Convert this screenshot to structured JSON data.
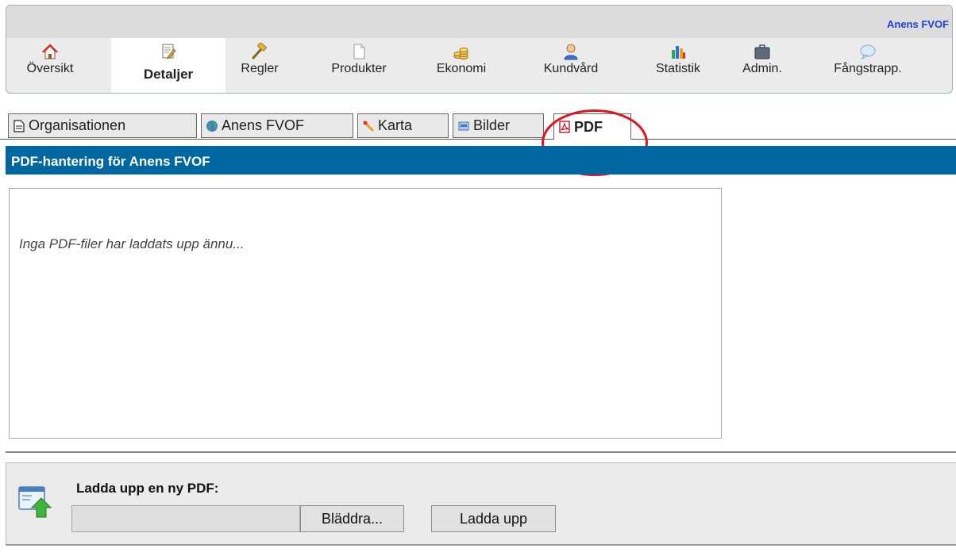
{
  "header": {
    "org_name": "Anens FVOF"
  },
  "nav": {
    "items": [
      {
        "label": "Översikt",
        "icon": "home-icon"
      },
      {
        "label": "Detaljer",
        "icon": "notepad-pencil-icon",
        "active": true
      },
      {
        "label": "Regler",
        "icon": "gavel-icon"
      },
      {
        "label": "Produkter",
        "icon": "document-icon"
      },
      {
        "label": "Ekonomi",
        "icon": "coins-icon"
      },
      {
        "label": "Kundvård",
        "icon": "user-icon"
      },
      {
        "label": "Statistik",
        "icon": "bar-chart-icon"
      },
      {
        "label": "Admin.",
        "icon": "briefcase-icon"
      },
      {
        "label": "Fångstrapp.",
        "icon": "speech-bubble-icon"
      }
    ]
  },
  "tabs": [
    {
      "label": "Organisationen",
      "icon": "document-icon"
    },
    {
      "label": "Anens FVOF",
      "icon": "globe-icon"
    },
    {
      "label": "Karta",
      "icon": "map-pin-icon"
    },
    {
      "label": "Bilder",
      "icon": "image-icon"
    },
    {
      "label": "PDF",
      "icon": "pdf-icon",
      "active": true
    }
  ],
  "section": {
    "title": "PDF-hantering för Anens FVOF"
  },
  "list": {
    "empty_message": "Inga PDF-filer har laddats upp ännu..."
  },
  "upload": {
    "label": "Ladda upp en ny PDF:",
    "file_value": "",
    "browse_label": "Bläddra...",
    "submit_label": "Ladda upp"
  },
  "colors": {
    "header_bar": "#0067a0",
    "org_link": "#1f3fd6",
    "highlight": "#e0141b"
  }
}
